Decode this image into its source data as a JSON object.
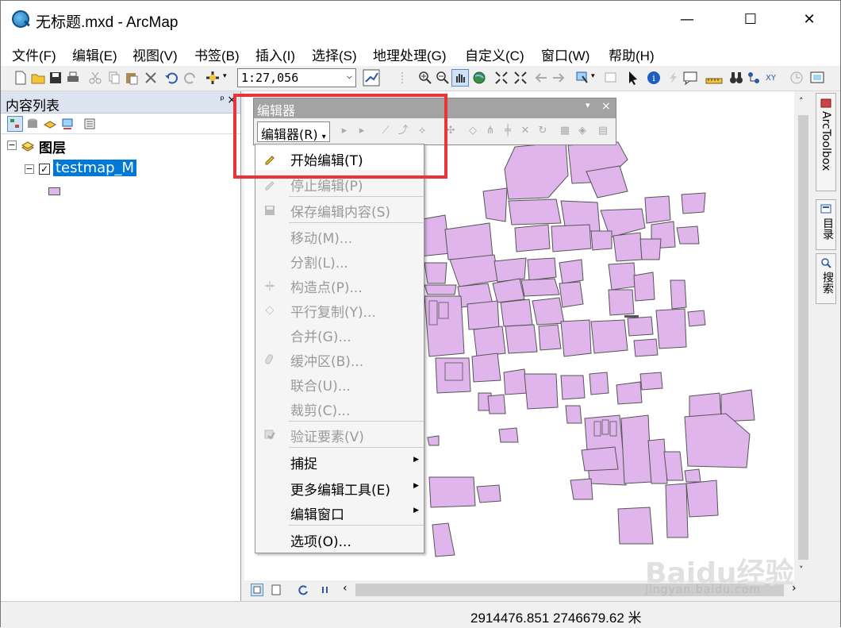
{
  "window": {
    "title": "无标题.mxd - ArcMap",
    "minimize": "—",
    "maximize": "☐",
    "close": "✕"
  },
  "menubar": [
    "文件(F)",
    "编辑(E)",
    "视图(V)",
    "书签(B)",
    "插入(I)",
    "选择(S)",
    "地理处理(G)",
    "自定义(C)",
    "窗口(W)",
    "帮助(H)"
  ],
  "toolbar": {
    "scale_value": "1:27,056"
  },
  "toc": {
    "title": "内容列表",
    "pin": "ᵖ",
    "close": "×",
    "layers_group": "图层",
    "layer_name": "testmap_M",
    "layer_checked": true,
    "symbol_color": "#e0b5ec"
  },
  "editor": {
    "title": "编辑器",
    "menu_button": "编辑器(R)",
    "items": [
      {
        "label": "开始编辑(T)",
        "enabled": true,
        "icon": "pencil-icon"
      },
      {
        "label": "停止编辑(P)",
        "enabled": false,
        "icon": "stop-edit-icon"
      },
      {
        "label": "保存编辑内容(S)",
        "enabled": false,
        "icon": "save-edits-icon"
      },
      {
        "label": "移动(M)...",
        "enabled": false,
        "icon": ""
      },
      {
        "label": "分割(L)...",
        "enabled": false,
        "icon": ""
      },
      {
        "label": "构造点(P)...",
        "enabled": false,
        "icon": "construct-points-icon"
      },
      {
        "label": "平行复制(Y)...",
        "enabled": false,
        "icon": "copy-parallel-icon"
      },
      {
        "label": "合并(G)...",
        "enabled": false,
        "icon": ""
      },
      {
        "label": "缓冲区(B)...",
        "enabled": false,
        "icon": "buffer-icon"
      },
      {
        "label": "联合(U)...",
        "enabled": false,
        "icon": ""
      },
      {
        "label": "裁剪(C)...",
        "enabled": false,
        "icon": ""
      },
      {
        "label": "验证要素(V)",
        "enabled": false,
        "icon": "validate-features-icon"
      },
      {
        "label": "捕捉",
        "enabled": true,
        "icon": "",
        "submenu": true
      },
      {
        "label": "更多编辑工具(E)",
        "enabled": true,
        "icon": "",
        "submenu": true
      },
      {
        "label": "编辑窗口",
        "enabled": true,
        "icon": "",
        "submenu": true
      },
      {
        "label": "选项(O)...",
        "enabled": true,
        "icon": ""
      }
    ]
  },
  "right_dock": {
    "tabs": [
      "ArcToolbox",
      "目录",
      "搜索"
    ]
  },
  "status": {
    "coordinates": "2914476.851  2746679.62 米"
  },
  "watermark": {
    "brand": "Baidu经验",
    "url": "jingyan.baidu.com"
  },
  "colors": {
    "polygon_fill": "#e0b5ec",
    "polygon_stroke": "#555555",
    "highlight": "#e8353a",
    "selection": "#0078d7"
  }
}
